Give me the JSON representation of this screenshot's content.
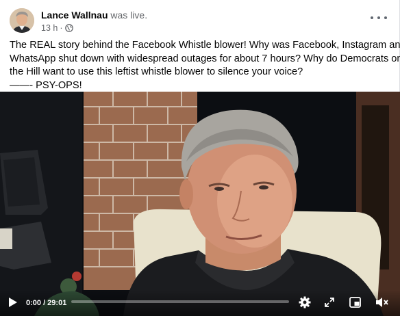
{
  "post": {
    "author_name": "Lance Wallnau",
    "status": "was live.",
    "timestamp": "13 h",
    "separator": "·",
    "privacy_icon": "globe-icon",
    "more_icon": "more-options-icon",
    "text_lines": [
      "The REAL story behind the Facebook Whistle blower! Why was Facebook, Instagram and",
      "WhatsApp shut down with widespread outages for about 7 hours? Why do Democrats on",
      "the Hill want to use this leftist whistle blower to silence your voice?",
      "——- PSY-OPS!"
    ]
  },
  "video": {
    "time_display": "0:00 / 29:01",
    "progress": 0.0,
    "icons": [
      "play-icon",
      "settings-icon",
      "fullscreen-icon",
      "miniplayer-icon",
      "volume-icon"
    ]
  },
  "colors": {
    "text": "#050505",
    "secondary": "#65676b",
    "video_bg": "#0b0d10"
  }
}
